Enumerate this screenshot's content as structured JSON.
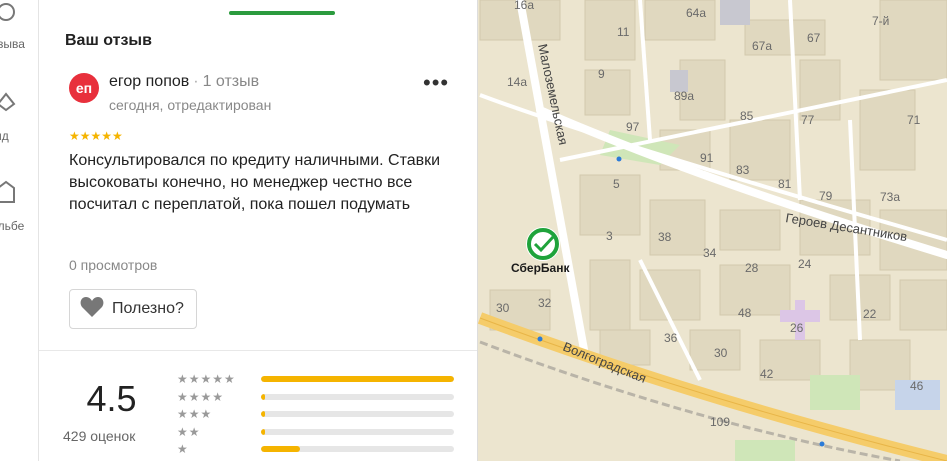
{
  "left_rail": {
    "items": [
      {
        "label": "отзыва",
        "icon": "reviews-icon"
      },
      {
        "label": "ид",
        "icon": "location-icon"
      },
      {
        "label": "альбе",
        "icon": "building-icon"
      }
    ]
  },
  "review_section": {
    "title": "Ваш отзыв"
  },
  "review": {
    "avatar_initials": "еп",
    "author_name": "егор попов",
    "author_reviews": "1 отзыв",
    "date": "сегодня, отредактирован",
    "stars": "★★★★★",
    "rating": 5,
    "text": "Консультировался по кредиту наличными. Ставки высоковаты конечно, но менеджер честно все посчитал с переплатой, пока пошел подумать",
    "views": "0 просмотров",
    "useful_label": "Полезно?",
    "more_label": "•••"
  },
  "summary": {
    "rating": "4.5",
    "count": "429 оценок",
    "distribution": [
      {
        "stars": "★★★★★",
        "fraction": 1.0
      },
      {
        "stars": "★★★★",
        "fraction": 0.02
      },
      {
        "stars": "★★★",
        "fraction": 0.02
      },
      {
        "stars": "★★",
        "fraction": 0.02
      },
      {
        "stars": "★",
        "fraction": 0.2
      }
    ]
  },
  "map": {
    "poi": {
      "name": "СберБанк",
      "icon": "sberbank-logo-icon",
      "brand_color": "#1fa33b"
    },
    "streets": [
      "Малоземельская",
      "Героев Десантников",
      "Волгоградская"
    ],
    "house_numbers": [
      "16а",
      "64а",
      "7-й",
      "11",
      "67",
      "67а",
      "14а",
      "9",
      "89а",
      "85",
      "77",
      "71",
      "97",
      "91",
      "83",
      "81",
      "79",
      "73а",
      "5",
      "3",
      "38",
      "34",
      "24",
      "32",
      "30",
      "28",
      "26",
      "22",
      "36",
      "48",
      "30",
      "42",
      "46",
      "109"
    ],
    "colors": {
      "background": "#ece5cf",
      "road": "#ffffff",
      "highway": "#f5cc6a",
      "building": "#e4dcc4",
      "park": "#cfe6b8"
    }
  }
}
